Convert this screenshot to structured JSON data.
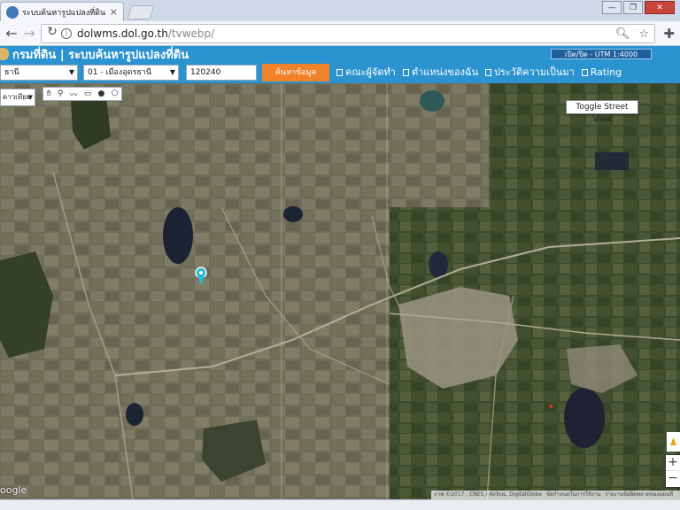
{
  "browser": {
    "tab_title": "ระบบค้นหารูปแปลงที่ดิน",
    "tab_close": "×",
    "window_buttons": [
      "—",
      "❐",
      "✕"
    ],
    "url_host": "dolwms.dol.go.th",
    "url_path": "/tvwebp/",
    "icons": [
      "back-arrow-icon",
      "forward-arrow-icon",
      "reload-icon",
      "info-icon",
      "zoom-icon",
      "star-icon",
      "extension-icon"
    ]
  },
  "app": {
    "title": "กรมที่ดิน | ระบบค้นหารูปแปลงที่ดิน",
    "utm_label": "เปิด/ปิด - UTM 1:4000",
    "brand_color": "#2b93cf",
    "accent_color": "#f0822c"
  },
  "search": {
    "province": "ธานี",
    "district": "01 - เมืองอุดรธานี",
    "parcel_no": "120240",
    "button_label": "ค้นหาข้อมูล"
  },
  "nav": {
    "items": [
      {
        "label": "คณะผู้จัดทำ"
      },
      {
        "label": "ตำแหน่งของฉัน"
      },
      {
        "label": "ประวัติความเป็นมา"
      },
      {
        "label": "Rating"
      }
    ]
  },
  "map": {
    "type_select": "ดาวเทียม",
    "toggle_street_view": "Toggle Street View",
    "tool_icons": [
      "pan-hand-icon",
      "marker-icon",
      "polyline-icon",
      "rectangle-icon",
      "circle-icon",
      "polygon-icon"
    ],
    "zoom_in": "+",
    "zoom_out": "−",
    "google_logo": "oogle",
    "attribution": [
      "ภาพ ©2017 , CNES / Airbus, DigitalGlobe",
      "ข้อกำหนดในการใช้งาน",
      "รายงานข้อผิดพลาดของแผนที่"
    ]
  }
}
